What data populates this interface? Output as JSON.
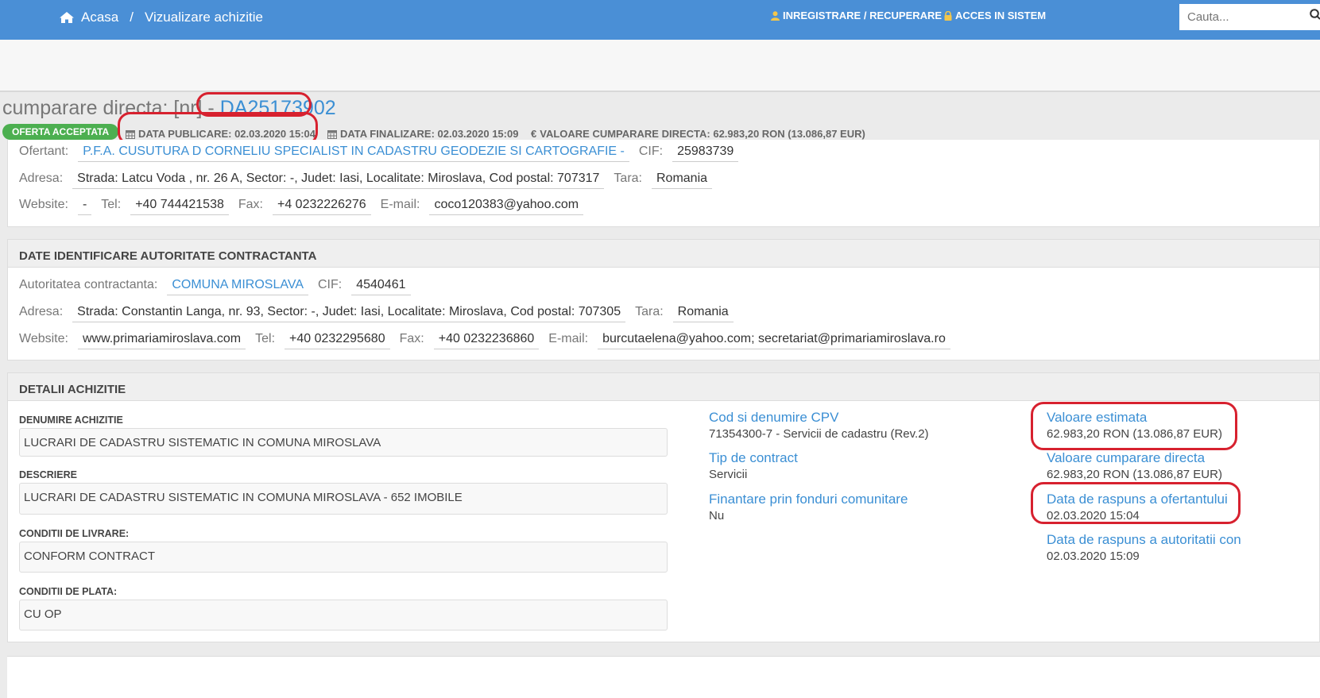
{
  "nav": {
    "home_label": "Acasa",
    "separator": "/",
    "current_label": "Vizualizare achizitie",
    "register_label": "INREGISTRARE / RECUPERARE",
    "login_label": "ACCES IN SISTEM",
    "search_placeholder": "Cauta..."
  },
  "header": {
    "title_prefix": "cumparare directa: [nr] - ",
    "code": "DA25173902",
    "status_badge": "OFERTA ACCEPTATA",
    "publish_date": "DATA PUBLICARE: 02.03.2020 15:04",
    "finalize_date": "DATA FINALIZARE: 02.03.2020 15:09",
    "value": "VALOARE CUMPARARE DIRECTA: 62.983,20  RON (13.086,87  EUR)"
  },
  "supplier": {
    "ofertant_label": "Ofertant:",
    "ofertant": "P.F.A. CUSUTURA D CORNELIU SPECIALIST IN CADASTRU GEODEZIE SI CARTOGRAFIE -",
    "cif_label": "CIF:",
    "cif": "25983739",
    "address_label": "Adresa:",
    "address": "Strada: Latcu Voda , nr. 26 A, Sector: -, Judet: Iasi, Localitate: Miroslava, Cod postal: 707317",
    "country_label": "Tara:",
    "country": "Romania",
    "website_label": "Website:",
    "website": "-",
    "tel_label": "Tel:",
    "tel": "+40 744421538",
    "fax_label": "Fax:",
    "fax": "+4 0232226276",
    "email_label": "E-mail:",
    "email": "coco120383@yahoo.com"
  },
  "authority": {
    "heading": "DATE IDENTIFICARE AUTORITATE CONTRACTANTA",
    "name_label": "Autoritatea contractanta:",
    "name": "COMUNA MIROSLAVA",
    "cif_label": "CIF:",
    "cif": "4540461",
    "address_label": "Adresa:",
    "address": "Strada: Constantin Langa, nr. 93, Sector: -, Judet: Iasi, Localitate: Miroslava, Cod postal: 707305",
    "country_label": "Tara:",
    "country": "Romania",
    "website_label": "Website:",
    "website": "www.primariamiroslava.com",
    "tel_label": "Tel:",
    "tel": "+40 0232295680",
    "fax_label": "Fax:",
    "fax": "+40 0232236860",
    "email_label": "E-mail:",
    "email": "burcutaelena@yahoo.com; secretariat@primariamiroslava.ro"
  },
  "details": {
    "heading": "DETALII ACHIZITIE",
    "name_label": "DENUMIRE ACHIZITIE",
    "name": "LUCRARI DE CADASTRU SISTEMATIC IN COMUNA MIROSLAVA",
    "description_label": "DESCRIERE",
    "description": "LUCRARI DE CADASTRU SISTEMATIC IN COMUNA MIROSLAVA - 652 IMOBILE",
    "delivery_label": "CONDITII DE LIVRARE:",
    "delivery": "CONFORM CONTRACT",
    "payment_label": "CONDITII DE PLATA:",
    "payment": "CU OP",
    "cpv_label": "Cod si denumire CPV",
    "cpv": "71354300-7 - Servicii de cadastru (Rev.2)",
    "contract_type_label": "Tip de contract",
    "contract_type": "Servicii",
    "eu_funds_label": "Finantare prin fonduri comunitare",
    "eu_funds": "Nu",
    "estimated_value_label": "Valoare estimata",
    "estimated_value": "62.983,20  RON (13.086,87  EUR)",
    "direct_value_label": "Valoare cumparare directa",
    "direct_value": "62.983,20  RON (13.086,87  EUR)",
    "supplier_reply_label": "Data de raspuns a ofertantului",
    "supplier_reply": "02.03.2020 15:04",
    "authority_reply_label": "Data de raspuns a autoritatii con",
    "authority_reply": "02.03.2020 15:09"
  },
  "colors": {
    "nav_bg": "#4a8fd6",
    "link": "#3b8fd4",
    "badge_green": "#4caf50",
    "highlight_red": "#d7212f"
  }
}
